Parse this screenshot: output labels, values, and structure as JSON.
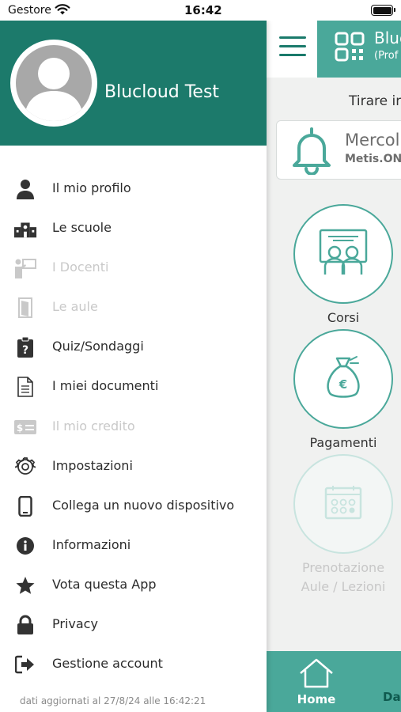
{
  "status_bar": {
    "carrier": "Gestore",
    "time": "16:42"
  },
  "main": {
    "school_name": "Bluc",
    "school_sub": "(Prof",
    "pull_text": "Tirare in",
    "notification": {
      "day": "Mercol",
      "source": "Metis.ON"
    },
    "tiles": [
      {
        "label": "Corsi",
        "enabled": true
      },
      {
        "label": "Pagamenti",
        "enabled": true
      },
      {
        "label": "Prenotazione Aule / Lezioni",
        "enabled": false
      }
    ],
    "tabbar": {
      "home_label": "Home",
      "next_label": "Das"
    }
  },
  "drawer": {
    "user_name": "Blucloud Test",
    "menu": [
      {
        "label": "Il mio profilo",
        "icon": "person-icon",
        "enabled": true
      },
      {
        "label": "Le scuole",
        "icon": "school-building-icon",
        "enabled": true
      },
      {
        "label": "I Docenti",
        "icon": "teacher-icon",
        "enabled": false
      },
      {
        "label": "Le aule",
        "icon": "door-icon",
        "enabled": false
      },
      {
        "label": "Quiz/Sondaggi",
        "icon": "clipboard-question-icon",
        "enabled": true
      },
      {
        "label": "I miei documenti",
        "icon": "document-icon",
        "enabled": true
      },
      {
        "label": "Il mio credito",
        "icon": "money-card-icon",
        "enabled": false
      },
      {
        "label": "Impostazioni",
        "icon": "gear-icon",
        "enabled": true
      },
      {
        "label": "Collega un nuovo dispositivo",
        "icon": "phone-icon",
        "enabled": true
      },
      {
        "label": "Informazioni",
        "icon": "info-icon",
        "enabled": true
      },
      {
        "label": "Vota questa App",
        "icon": "star-icon",
        "enabled": true
      },
      {
        "label": "Privacy",
        "icon": "lock-icon",
        "enabled": true
      },
      {
        "label": "Gestione account",
        "icon": "sign-out-icon",
        "enabled": true
      }
    ],
    "footer_note": "dati aggiornati al 27/8/24 alle 16:42:21"
  },
  "colors": {
    "drawer_header": "#1c7a6b",
    "accent": "#4aa89a",
    "disabled_text": "#c9c9c9"
  }
}
